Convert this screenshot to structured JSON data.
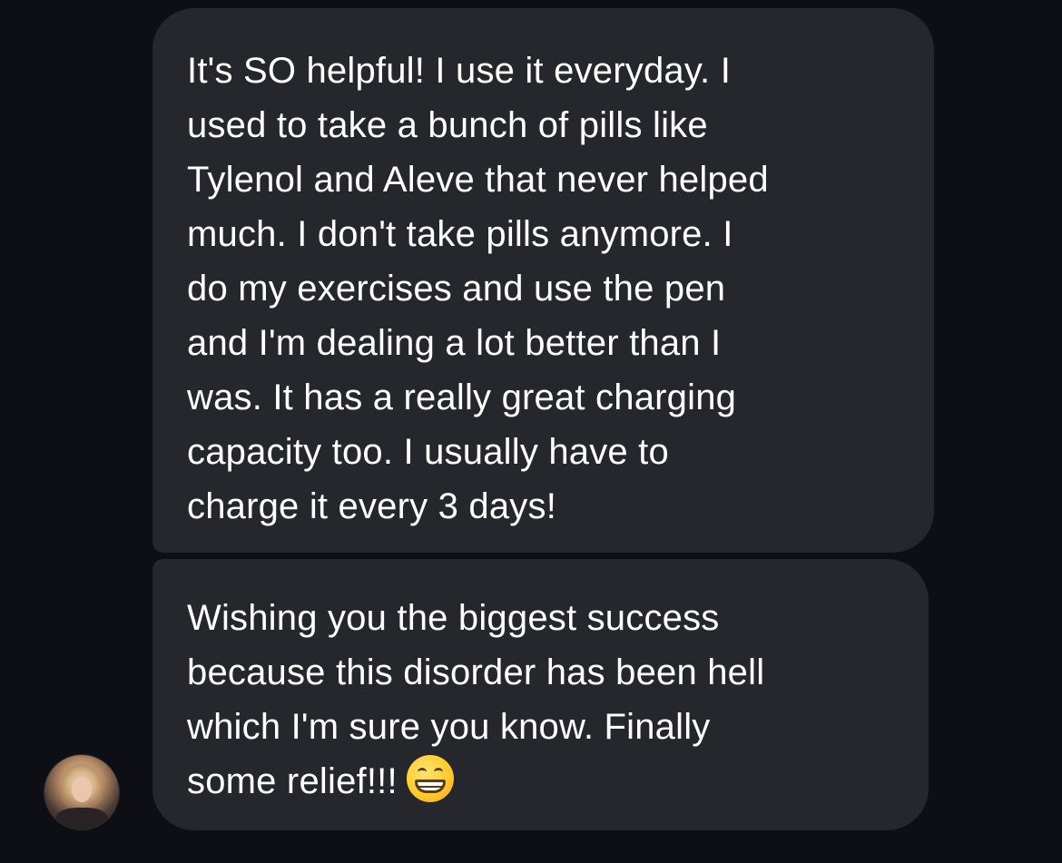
{
  "messages": [
    {
      "lines": [
        "It's SO helpful! I use it everyday. I",
        "used to take a bunch of pills like",
        "Tylenol and Aleve that never helped",
        "much. I don't take pills anymore. I",
        "do my exercises and use the pen",
        "and I'm dealing a lot better than I",
        "was. It has a really great charging",
        "capacity too. I usually have to",
        "charge it every 3 days!"
      ]
    },
    {
      "lines": [
        "Wishing you the biggest success",
        "because this disorder has been hell",
        "which I'm sure you know. Finally",
        "some relief!!!"
      ],
      "emoji": "grinning-face-with-smiling-eyes"
    }
  ],
  "colors": {
    "background": "#0d0f14",
    "bubble": "#26272c",
    "text": "#ffffff"
  }
}
